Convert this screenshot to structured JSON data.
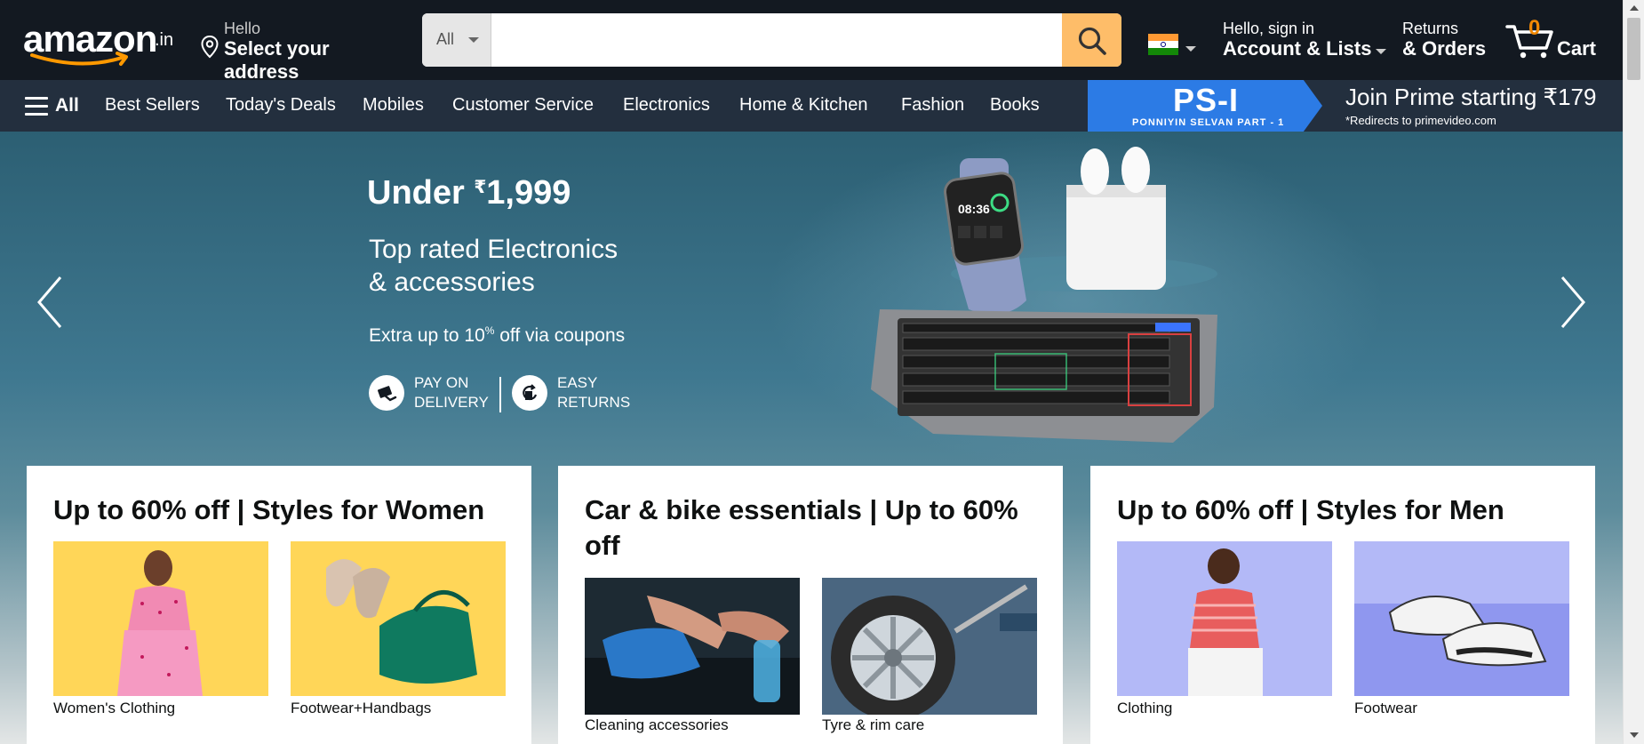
{
  "header": {
    "logo_text": "amazon",
    "logo_tld": ".in",
    "address_line1": "Hello",
    "address_line2": "Select your address",
    "search_category": "All",
    "search_placeholder": "",
    "account_line1": "Hello, sign in",
    "account_line2": "Account & Lists",
    "orders_line1": "Returns",
    "orders_line2": "& Orders",
    "cart_count": "0",
    "cart_label": "Cart"
  },
  "nav": {
    "all_label": "All",
    "items": [
      "Best Sellers",
      "Today's Deals",
      "Mobiles",
      "Customer Service",
      "Electronics",
      "Home & Kitchen",
      "Fashion",
      "Books"
    ]
  },
  "prime_banner": {
    "ps_title": "PS-I",
    "ps_subtitle": "PONNIYIN SELVAN PART - 1",
    "headline": "Join Prime starting ₹179",
    "subline": "*Redirects to primevideo.com"
  },
  "hero": {
    "title_prefix": "Under ",
    "currency": "₹",
    "price": "1,999",
    "subtitle_line1": "Top rated Electronics",
    "subtitle_line2": "& accessories",
    "offer_prefix": "Extra up to 10",
    "offer_percent": "%",
    "offer_suffix": " off via coupons",
    "badge1_line1": "PAY ON",
    "badge1_line2": "DELIVERY",
    "badge2_line1": "EASY",
    "badge2_line2": "RETURNS",
    "watch_time": "08:36"
  },
  "cards": [
    {
      "title": "Up to 60% off | Styles for Women",
      "tiles": [
        {
          "caption": "Women's Clothing"
        },
        {
          "caption": "Footwear+Handbags"
        }
      ]
    },
    {
      "title": "Car & bike essentials | Up to 60% off",
      "tiles": [
        {
          "caption": "Cleaning accessories"
        },
        {
          "caption": "Tyre & rim care"
        }
      ]
    },
    {
      "title": "Up to 60% off | Styles for Men",
      "tiles": [
        {
          "caption": "Clothing"
        },
        {
          "caption": "Footwear"
        }
      ]
    }
  ],
  "colors": {
    "header_bg": "#131921",
    "nav_bg": "#232f3e",
    "search_button": "#febd69",
    "cart_count": "#f08804",
    "logo_smile": "#ff9900"
  }
}
